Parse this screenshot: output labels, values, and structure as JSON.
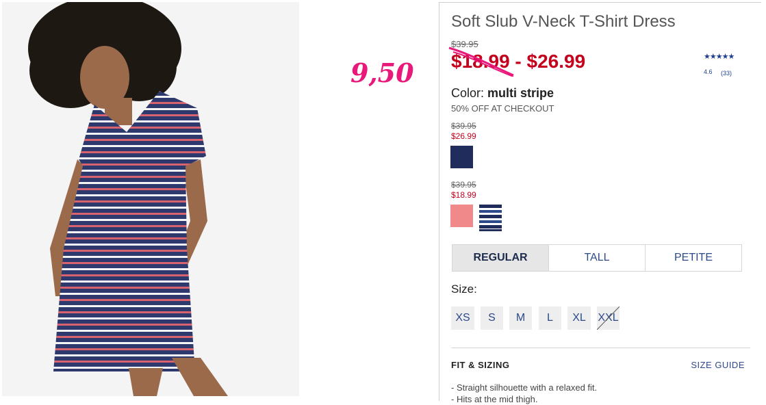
{
  "annotation": "9,50",
  "product": {
    "title": "Soft Slub V-Neck T-Shirt Dress",
    "original_price": "$39.95",
    "price_range": "$18.99 - $26.99",
    "rating_value": "4.6",
    "rating_count": "(33)",
    "rating_stars": "★★★★★",
    "color_label": "Color:",
    "color_value": "multi stripe",
    "offer": "50% OFF AT CHECKOUT"
  },
  "price_groups": [
    {
      "original": "$39.95",
      "sale": "$26.99"
    },
    {
      "original": "$39.95",
      "sale": "$18.99"
    }
  ],
  "fit_tabs": [
    "REGULAR",
    "TALL",
    "PETITE"
  ],
  "size_label": "Size:",
  "sizes": [
    "XS",
    "S",
    "M",
    "L",
    "XL",
    "XXL"
  ],
  "fit_sizing": {
    "heading": "FIT & SIZING",
    "size_guide": "SIZE GUIDE",
    "bullets": [
      "- Straight silhouette with a relaxed fit.",
      "- Hits at the mid thigh."
    ]
  },
  "colors": {
    "sale_red": "#c4001d",
    "annotation_pink": "#e8197a",
    "link_blue": "#2c4a8a",
    "navy_swatch": "#1f2c5c",
    "pink_swatch": "#f08a8a"
  }
}
